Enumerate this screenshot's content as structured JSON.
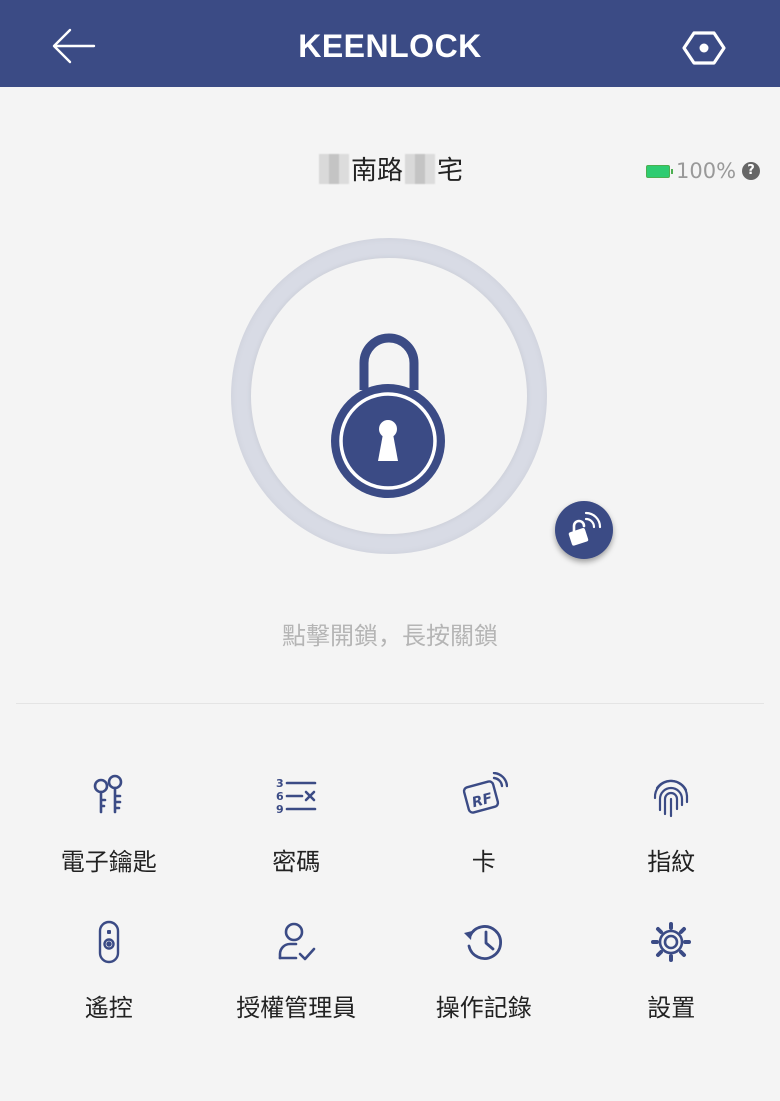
{
  "header": {
    "title": "KEENLOCK",
    "back_icon": "arrow-left-icon",
    "settings_icon": "hexagon-icon"
  },
  "lock": {
    "name_parts": [
      "南路",
      "宅"
    ],
    "battery": "100%",
    "hint": "點擊開鎖，長按關鎖"
  },
  "menu": {
    "items": [
      {
        "label": "電子鑰匙",
        "icon": "keys-icon"
      },
      {
        "label": "密碼",
        "icon": "passcode-icon"
      },
      {
        "label": "卡",
        "icon": "rf-card-icon"
      },
      {
        "label": "指紋",
        "icon": "fingerprint-icon"
      },
      {
        "label": "遙控",
        "icon": "remote-icon"
      },
      {
        "label": "授權管理員",
        "icon": "admin-user-icon"
      },
      {
        "label": "操作記錄",
        "icon": "history-icon"
      },
      {
        "label": "設置",
        "icon": "gear-icon"
      }
    ]
  },
  "colors": {
    "brand": "#3b4b85",
    "battery_ok": "#2ecc71"
  }
}
